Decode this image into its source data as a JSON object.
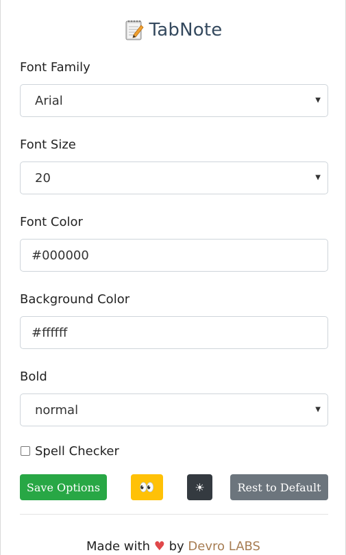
{
  "header": {
    "title": "TabNote",
    "logo_icon": "notepad-icon"
  },
  "fields": {
    "font_family": {
      "label": "Font Family",
      "value": "Arial"
    },
    "font_size": {
      "label": "Font Size",
      "value": "20"
    },
    "font_color": {
      "label": "Font Color",
      "value": "#000000"
    },
    "background_color": {
      "label": "Background Color",
      "value": "#ffffff"
    },
    "bold": {
      "label": "Bold",
      "value": "normal"
    }
  },
  "spell_checker": {
    "label": "Spell Checker",
    "checked": false
  },
  "buttons": {
    "save": "Save Options",
    "eyes": "👀",
    "theme": "☀",
    "reset": "Rest to Default"
  },
  "footer": {
    "made_with": "Made with",
    "heart": "♥",
    "by": "by",
    "brand": "Devro LABS"
  },
  "colors": {
    "save": "#28a745",
    "eyes": "#ffc107",
    "theme": "#343a40",
    "reset": "#6c757d",
    "heart": "#e0484a",
    "brand": "#a67c52",
    "title": "#34495e"
  }
}
